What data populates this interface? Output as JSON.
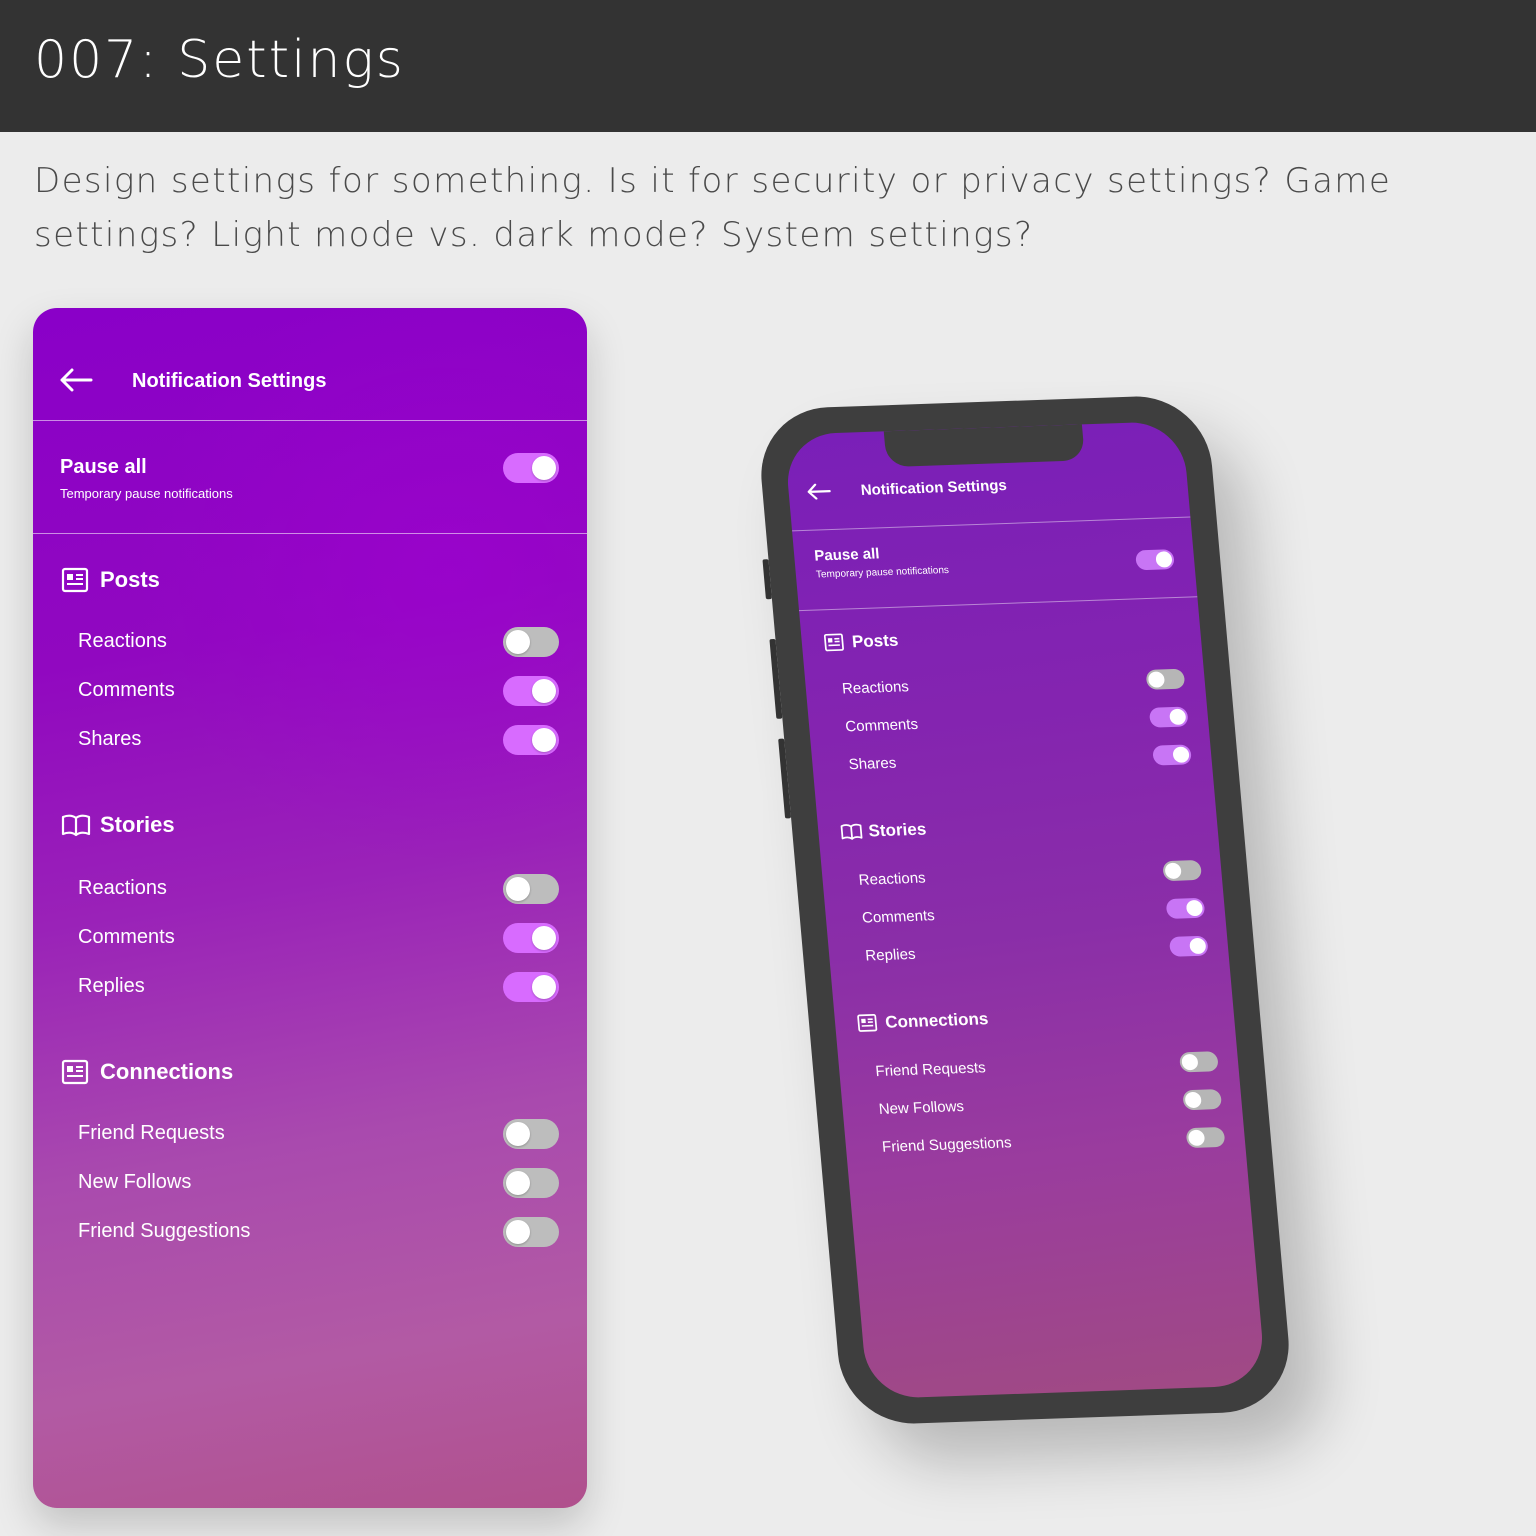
{
  "banner": {
    "title": "007: Settings",
    "prompt": "Design settings for something. Is it for security or privacy settings? Game settings? Light mode vs. dark mode? System settings?"
  },
  "app": {
    "header_title": "Notification Settings",
    "back_icon": "arrow-left-icon",
    "pause": {
      "label": "Pause all",
      "subtitle": "Temporary pause notifications",
      "on": true
    },
    "sections": [
      {
        "title": "Posts",
        "icon": "newspaper-icon",
        "items": [
          {
            "label": "Reactions",
            "on": false
          },
          {
            "label": "Comments",
            "on": true
          },
          {
            "label": "Shares",
            "on": true
          }
        ]
      },
      {
        "title": "Stories",
        "icon": "open-book-icon",
        "items": [
          {
            "label": "Reactions",
            "on": false
          },
          {
            "label": "Comments",
            "on": true
          },
          {
            "label": "Replies",
            "on": true
          }
        ]
      },
      {
        "title": "Connections",
        "icon": "newspaper-icon",
        "items": [
          {
            "label": "Friend Requests",
            "on": false
          },
          {
            "label": "New Follows",
            "on": false
          },
          {
            "label": "Friend Suggestions",
            "on": false
          }
        ]
      }
    ]
  },
  "colors": {
    "toggle_on": "#d86bff",
    "toggle_off": "#bdbdbd",
    "banner_bg": "#333333",
    "page_bg": "#ececec"
  }
}
